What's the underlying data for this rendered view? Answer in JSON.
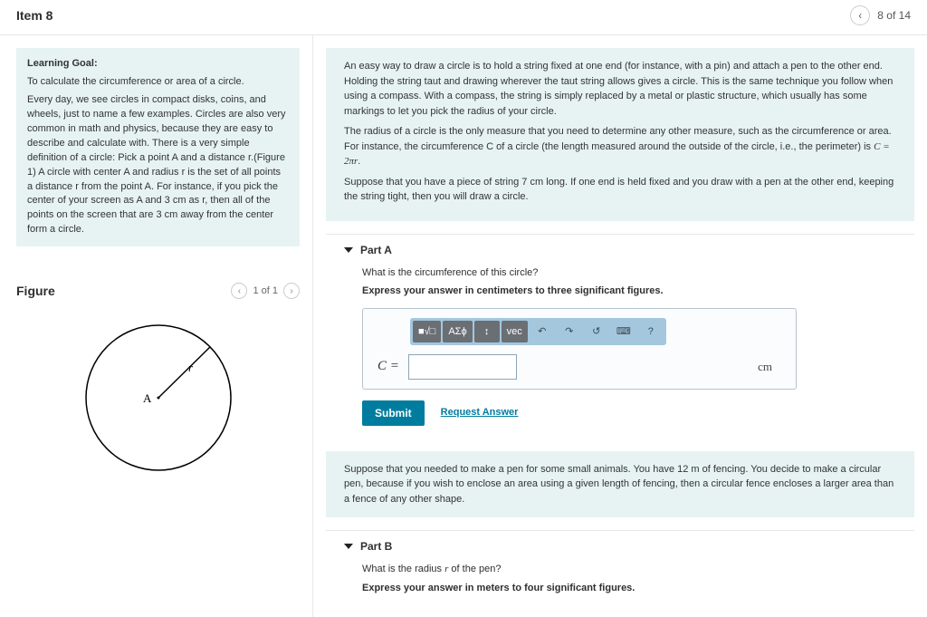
{
  "header": {
    "title": "Item 8",
    "page_text": "8 of 14"
  },
  "learning_goal": {
    "label": "Learning Goal:",
    "goal": "To calculate the circumference or area of a circle.",
    "para": "Every day, we see circles in compact disks, coins, and wheels, just to name a few examples. Circles are also very common in math and physics, because they are easy to describe and calculate with. There is a very simple definition of a circle: Pick a point A and a distance r.(Figure 1) A circle with center A and radius r is the set of all points a distance r from the point A. For instance, if you pick the center of your screen as A and 3 cm as r, then all of the points on the screen that are 3 cm away from the center form a circle."
  },
  "figure": {
    "title": "Figure",
    "page_text": "1 of 1",
    "center_label": "A",
    "radius_label": "r"
  },
  "intro": {
    "p1": "An easy way to draw a circle is to hold a string fixed at one end (for instance, with a pin) and attach a pen to the other end. Holding the string taut and drawing wherever the taut string allows gives a circle. This is the same technique you follow when using a compass. With a compass, the string is simply replaced by a metal or plastic structure, which usually has some markings to let you pick the radius of your circle.",
    "p2_a": "The radius of a circle is the only measure that you need to determine any other measure, such as the circumference or area. For instance, the circumference C of a circle (the length measured around the outside of the circle, i.e., the perimeter) is ",
    "p2_formula": "C = 2πr",
    "p2_b": ".",
    "p3": "Suppose that you have a piece of string 7 cm long. If one end is held fixed and you draw with a pen at the other end, keeping the string tight, then you will draw a circle."
  },
  "partA": {
    "title": "Part A",
    "question": "What is the circumference of this circle?",
    "instruction": "Express your answer in centimeters to three significant figures.",
    "toolbar": {
      "tmpl": "■√□",
      "greek": "ΑΣϕ",
      "sort": "↕",
      "vec": "vec",
      "undo": "↶",
      "redo": "↷",
      "reset": "↺",
      "kbd": "⌨",
      "help": "?"
    },
    "eq_label": "C =",
    "unit": "cm",
    "submit": "Submit",
    "request": "Request Answer"
  },
  "mid": {
    "text": "Suppose that you needed to make a pen for some small animals. You have 12 m of fencing. You decide to make a circular pen, because if you wish to enclose an area using a given length of fencing, then a circular fence encloses a larger area than a fence of any other shape."
  },
  "partB": {
    "title": "Part B",
    "question_a": "What is the radius ",
    "question_var": "r",
    "question_b": " of the pen?",
    "instruction": "Express your answer in meters to four significant figures."
  }
}
